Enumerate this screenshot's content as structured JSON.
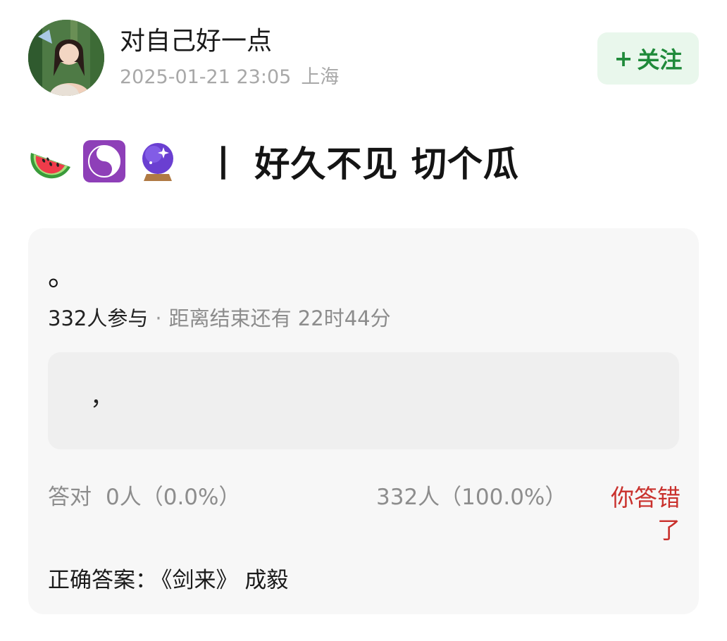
{
  "author": {
    "name": "对自己好一点",
    "timestamp": "2025-01-21 23:05",
    "location": "上海"
  },
  "follow_button": {
    "plus": "+",
    "label": "关注"
  },
  "post": {
    "emojis": [
      "watermelon-icon",
      "yin-yang-icon",
      "crystal-ball-icon"
    ],
    "separator": "丨",
    "title": "好久不见 切个瓜"
  },
  "poll": {
    "question": "。",
    "participants": "332人参与",
    "dot": "·",
    "countdown": "距离结束还有 22时44分",
    "option_text": "，",
    "correct_label": "答对",
    "correct_stat": "0人（0.0%）",
    "other_stat": "332人（100.0%）",
    "wrong_status": "你答错了",
    "answer_label": "正确答案：",
    "answer_value": "《剑来》 成毅"
  },
  "colors": {
    "follow_bg": "#e9f7ec",
    "follow_text": "#1f8a3a",
    "wrong_text": "#c9302c",
    "card_bg": "#f7f7f7",
    "option_bg": "#efefef"
  }
}
